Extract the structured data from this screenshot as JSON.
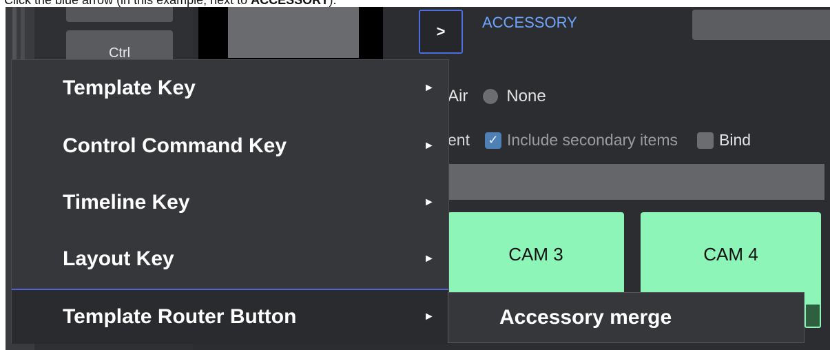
{
  "instruction": {
    "prefix": "Click the blue arrow (in this example, next to ",
    "bold": "ACCESSORY",
    "suffix": ")."
  },
  "left_panel": {
    "ctrl_key_label": "Ctrl"
  },
  "header": {
    "arrow_button_label": ">",
    "section_title": "ACCESSORY"
  },
  "options": {
    "radio_fragment": "Air",
    "radio_none_label": "None",
    "check_fragment": "ent",
    "include_secondary_label": "Include secondary items",
    "bind_label": "Bind"
  },
  "cameras": [
    {
      "label": "CAM 3"
    },
    {
      "label": "CAM 4"
    }
  ],
  "context_menu": {
    "items": [
      {
        "label": "Template Key"
      },
      {
        "label": "Control Command Key"
      },
      {
        "label": "Timeline Key"
      },
      {
        "label": "Layout Key"
      },
      {
        "label": "Template Router Button"
      }
    ],
    "submenu_arrow": "►",
    "submenu_item": "Accessory merge"
  },
  "colors": {
    "accent_blue": "#4d6ee0",
    "title_blue": "#6fa6ff",
    "cam_green": "#8df5b8",
    "menu_bg": "#36373b"
  }
}
